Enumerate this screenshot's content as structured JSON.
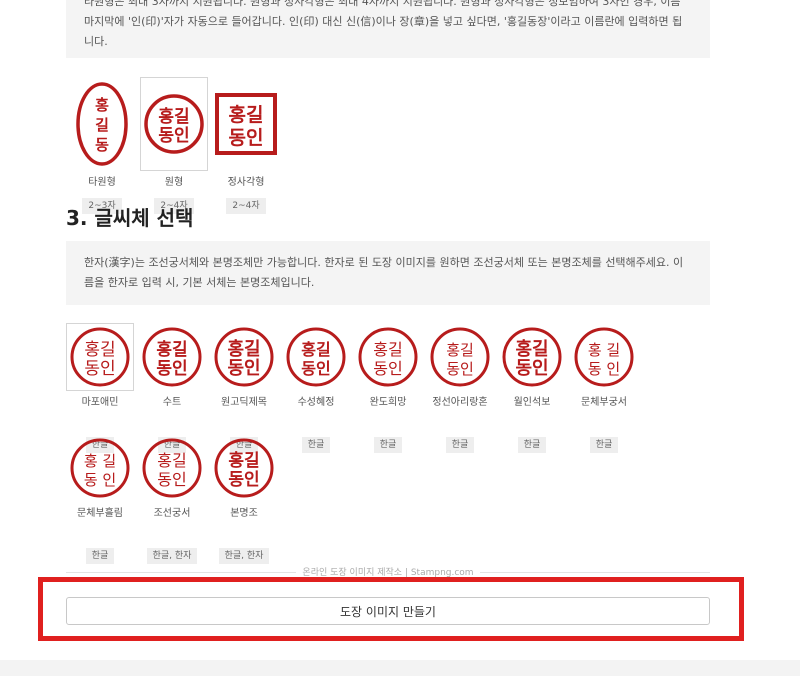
{
  "intro_text": "타원형은 최대 3자까지 지원됩니다. 원형과 정사각형은 최대 4자까지 지원됩니다. 원형과 정사각형은 정보임하여 3자인 경우, 이름 마지막에 '인(印)'자가 자동으로 들어갑니다. 인(印) 대신 신(信)이나 장(章)을 넣고 싶다면, '홍길동장'이라고 이름란에 입력하면 됩니다.",
  "shapes": [
    {
      "label": "타원형",
      "badge": "2~3자",
      "stamp_text": "홍길동",
      "shape": "oval"
    },
    {
      "label": "원형",
      "badge": "2~4자",
      "stamp_text": "홍길동인",
      "shape": "circle",
      "selected": true
    },
    {
      "label": "정사각형",
      "badge": "2~4자",
      "stamp_text": "홍길동인",
      "shape": "square"
    }
  ],
  "section3": {
    "title": "3. 글씨체 선택",
    "info": "한자(漢字)는 조선궁서체와 본명조체만 가능합니다. 한자로 된 도장 이미지를 원하면 조선궁서체 또는 본명조체를 선택해주세요. 이름을 한자로 입력 시, 기본 서체는 본명조체입니다."
  },
  "fonts": [
    {
      "label": "마포애민",
      "badge": "한글",
      "selected": true
    },
    {
      "label": "수트",
      "badge": "한글"
    },
    {
      "label": "원고딕제목",
      "badge": "한글"
    },
    {
      "label": "수성혜정",
      "badge": "한글"
    },
    {
      "label": "완도희망",
      "badge": "한글"
    },
    {
      "label": "정선아리랑혼",
      "badge": "한글"
    },
    {
      "label": "월인석보",
      "badge": "한글"
    },
    {
      "label": "문체부궁서",
      "badge": "한글"
    },
    {
      "label": "문체부흘림",
      "badge": "한글"
    },
    {
      "label": "조선궁서",
      "badge": "한글, 한자"
    },
    {
      "label": "본명조",
      "badge": "한글, 한자"
    }
  ],
  "stamp_text": {
    "line1": "홍길",
    "line2": "동인",
    "split1": "홍 길",
    "split2": "동 인"
  },
  "footer_text": "온라인 도장 이미지 제작소 | Stampng.com",
  "make_button_label": "도장 이미지 만들기",
  "colors": {
    "stamp": "#b71c1c",
    "highlight": "#e0201f"
  }
}
